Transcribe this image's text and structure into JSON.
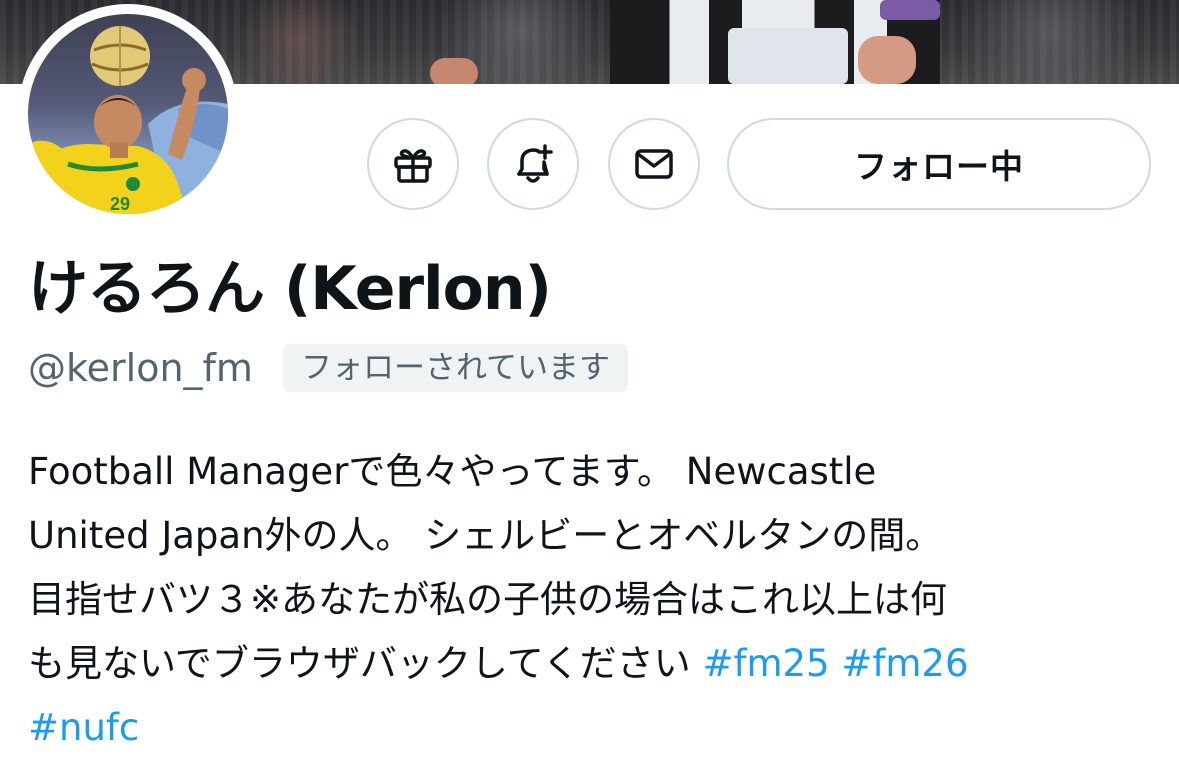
{
  "profile": {
    "display_name": "けるろん (Kerlon)",
    "handle": "@kerlon_fm",
    "follows_you_badge": "フォローされています",
    "follow_button_label": "フォロー中"
  },
  "icons": {
    "gift": "gift-icon",
    "bell": "notification-bell-plus-icon",
    "mail": "mail-icon"
  },
  "bio": {
    "lines": [
      "Football Managerで色々やってます。 Newcastle",
      "United Japan外の人。 シェルビーとオベルタンの間。",
      "目指せバツ３※あなたが私の子供の場合はこれ以上は何",
      "も見ないでブラウザバックしてください "
    ],
    "hashtags": [
      "#fm25",
      "#fm26",
      "#nufc"
    ]
  },
  "colors": {
    "link": "#1d9bf0",
    "text": "#0f1419",
    "secondary_text": "#536471",
    "border": "#cfd9de",
    "badge_bg": "#eff3f4"
  }
}
